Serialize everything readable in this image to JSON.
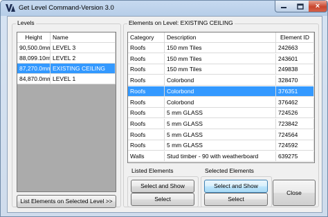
{
  "window": {
    "title": "Get Level Command-Version 3.0",
    "icon": "app-logo-icon",
    "controls": {
      "minimize": "minimize-icon",
      "maximize": "maximize-icon",
      "close": "×"
    }
  },
  "levels": {
    "group_title": "Levels",
    "columns": [
      "Height",
      "Name"
    ],
    "rows": [
      {
        "height": "90,500.0mm",
        "name": "LEVEL 3",
        "selected": false
      },
      {
        "height": "88,099.10mm",
        "name": "LEVEL 2",
        "selected": false
      },
      {
        "height": "87,270.0mm",
        "name": "EXISTING CEILING",
        "selected": true
      },
      {
        "height": "84,870.0mm",
        "name": "LEVEL 1",
        "selected": false
      }
    ],
    "list_button": "List Elements on Selected Level >>"
  },
  "elements": {
    "group_title": "Elements on Level: EXISTING CEILING",
    "columns": [
      "Category",
      "Description",
      "Element ID"
    ],
    "rows": [
      {
        "category": "Roofs",
        "description": "150 mm Tiles",
        "id": "242663",
        "selected": false
      },
      {
        "category": "Roofs",
        "description": "150 mm Tiles",
        "id": "243601",
        "selected": false
      },
      {
        "category": "Roofs",
        "description": "150 mm Tiles",
        "id": "249838",
        "selected": false
      },
      {
        "category": "Roofs",
        "description": "Colorbond",
        "id": "328470",
        "selected": false
      },
      {
        "category": "Roofs",
        "description": "Colorbond",
        "id": "376351",
        "selected": true
      },
      {
        "category": "Roofs",
        "description": "Colorbond",
        "id": "376462",
        "selected": false
      },
      {
        "category": "Roofs",
        "description": "5 mm GLASS",
        "id": "724526",
        "selected": false
      },
      {
        "category": "Roofs",
        "description": "5 mm GLASS",
        "id": "723842",
        "selected": false
      },
      {
        "category": "Roofs",
        "description": "5 mm GLASS",
        "id": "724564",
        "selected": false
      },
      {
        "category": "Roofs",
        "description": "5 mm GLASS",
        "id": "724592",
        "selected": false
      },
      {
        "category": "Walls",
        "description": "Stud timber - 90 with weatherboard",
        "id": "639275",
        "selected": false
      }
    ]
  },
  "listed_elements": {
    "group_title": "Listed Elements",
    "select_and_show": "Select and Show",
    "select": "Select"
  },
  "selected_elements": {
    "group_title": "Selected Elements",
    "select_and_show": "Select and Show",
    "select": "Select"
  },
  "close_button": "Close",
  "colors": {
    "selection": "#3399ff",
    "list_background": "#ababab",
    "close_button": "#c8452d"
  }
}
